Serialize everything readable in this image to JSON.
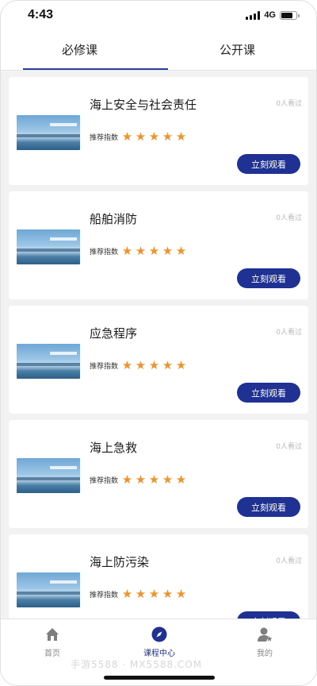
{
  "status_bar": {
    "time": "4:43",
    "network": "4G"
  },
  "tabs": [
    {
      "label": "必修课",
      "active": true
    },
    {
      "label": "公开课",
      "active": false
    }
  ],
  "courses": [
    {
      "title": "海上安全与社会责任",
      "viewers": "0人看过",
      "rating_label": "推荐指数",
      "stars": 5,
      "button_label": "立刻观看"
    },
    {
      "title": "船舶消防",
      "viewers": "0人看过",
      "rating_label": "推荐指数",
      "stars": 5,
      "button_label": "立刻观看"
    },
    {
      "title": "应急程序",
      "viewers": "0人看过",
      "rating_label": "推荐指数",
      "stars": 5,
      "button_label": "立刻观看"
    },
    {
      "title": "海上急救",
      "viewers": "0人看过",
      "rating_label": "推荐指数",
      "stars": 5,
      "button_label": "立刻观看"
    },
    {
      "title": "海上防污染",
      "viewers": "0人看过",
      "rating_label": "推荐指数",
      "stars": 5,
      "button_label": "立刻观看"
    }
  ],
  "bottom_nav": {
    "items": [
      {
        "label": "首页",
        "icon": "home-icon",
        "active": false
      },
      {
        "label": "课程中心",
        "icon": "compass-icon",
        "active": true
      },
      {
        "label": "我的",
        "icon": "profile-icon",
        "active": false
      }
    ]
  },
  "watermark": "手游5588 · MX5588.COM",
  "colors": {
    "accent": "#1f3192",
    "star": "#f0922e",
    "background": "#f2f2f2"
  }
}
